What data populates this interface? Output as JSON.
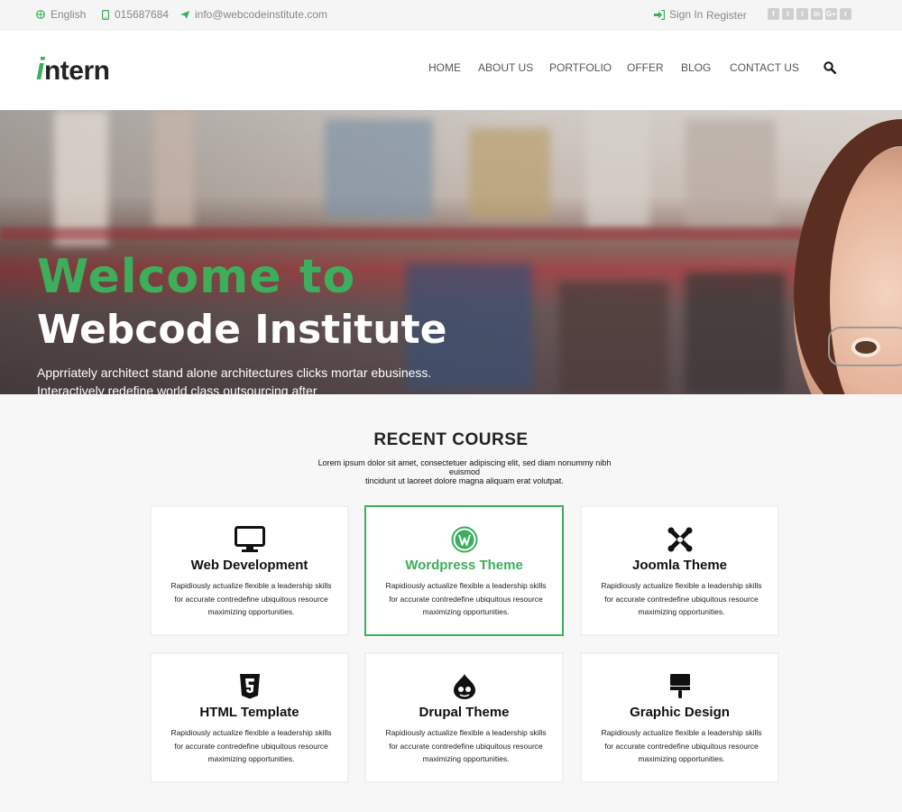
{
  "topbar": {
    "language": "English",
    "phone": "015687684",
    "email": "info@webcodeinstitute.com",
    "signin": "Sign In",
    "register": "Register",
    "socials": [
      {
        "icon": "facebook-icon",
        "glyph": "f"
      },
      {
        "icon": "twitter-icon",
        "glyph": "t"
      },
      {
        "icon": "tumblr-icon",
        "glyph": "t"
      },
      {
        "icon": "linkedin-icon",
        "glyph": "in"
      },
      {
        "icon": "googleplus-icon",
        "glyph": "G+"
      },
      {
        "icon": "rss-icon",
        "glyph": "r"
      }
    ]
  },
  "header": {
    "logo_i": "i",
    "logo_rest": "ntern",
    "nav": [
      "HOME",
      "ABOUT US",
      "PORTFOLIO",
      "OFFER",
      "BLOG",
      "CONTACT US"
    ]
  },
  "hero": {
    "title1": "Welcome to",
    "title2": "Webcode Institute",
    "desc_line1": "Apprriately architect stand alone architectures clicks mortar ebusiness.",
    "desc_line2": "Interactively redefine world class outsourcing after"
  },
  "courses": {
    "title": "RECENT COURSE",
    "subtitle_line1": "Lorem ipsum dolor sit amet, consectetuer adipiscing elit, sed diam nonummy nibh euismod",
    "subtitle_line2": "tincidunt ut laoreet dolore magna aliquam erat volutpat.",
    "items": [
      {
        "icon": "monitor-icon",
        "title": "Web Development",
        "text": "Rapidiously actualize flexible a leadership skills for accurate contredefine ubiquitous resource maximizing opportunities."
      },
      {
        "icon": "wordpress-icon",
        "title": "Wordpress Theme",
        "text": "Rapidiously actualize flexible a leadership skills for accurate contredefine ubiquitous resource maximizing opportunities."
      },
      {
        "icon": "joomla-icon",
        "title": "Joomla Theme",
        "text": "Rapidiously actualize flexible a leadership skills for accurate contredefine ubiquitous resource maximizing opportunities."
      },
      {
        "icon": "html5-icon",
        "title": "HTML Template",
        "text": "Rapidiously actualize flexible a leadership skills for accurate contredefine ubiquitous resource maximizing opportunities."
      },
      {
        "icon": "drupal-icon",
        "title": "Drupal Theme",
        "text": "Rapidiously actualize flexible a leadership skills for accurate contredefine ubiquitous resource maximizing opportunities."
      },
      {
        "icon": "paint-brush-icon",
        "title": "Graphic Design",
        "text": "Rapidiously actualize flexible a leadership skills for accurate contredefine ubiquitous resource maximizing opportunities."
      }
    ]
  },
  "colors": {
    "accent": "#3cae5c",
    "text": "#222222",
    "topbar_bg": "#f5f5f5"
  }
}
